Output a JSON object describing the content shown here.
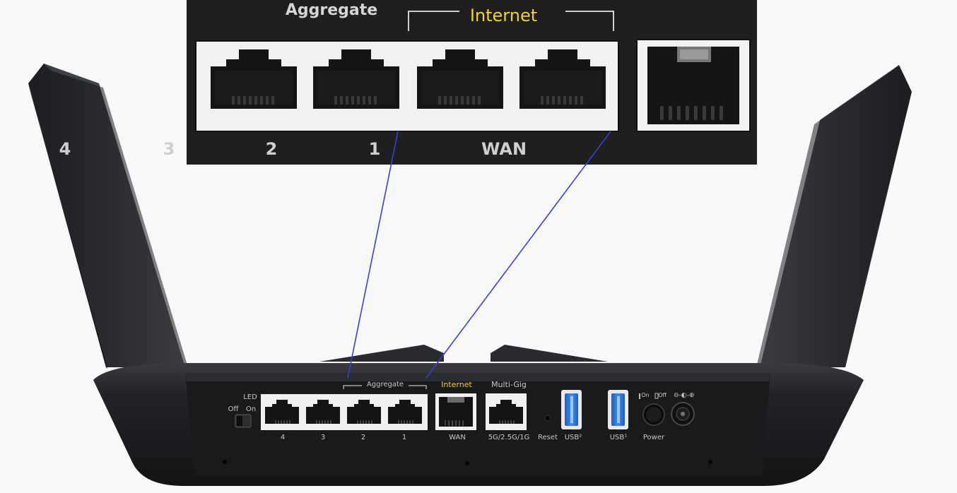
{
  "inset": {
    "aggregate_label": "Aggregate",
    "internet_label": "Internet",
    "port_numbers": [
      "4",
      "3",
      "2",
      "1"
    ],
    "wan_label": "WAN"
  },
  "panel": {
    "led_label": "LED",
    "led_off": "Off",
    "led_on": "On",
    "aggregate_label": "Aggregate",
    "internet_label": "Internet",
    "multigig_label": "Multi-Gig",
    "port_numbers": [
      "4",
      "3",
      "2",
      "1"
    ],
    "wan_label": "WAN",
    "multigig_speed": "5G/2.5G/1G",
    "reset_label": "Reset",
    "usb2_label": "USB²",
    "usb1_label": "USB¹",
    "power_label": "Power",
    "power_on": "On",
    "power_off": "Off",
    "dc_symbol": "⊖-◐-⊕"
  },
  "colors": {
    "internet_highlight": "#f2d320",
    "connector_lines": "#3d3dd8",
    "usb_blue": "#2f7ee0"
  },
  "icons": [
    "ethernet-port-icon",
    "usb-port-icon",
    "power-button-icon",
    "dc-jack-icon",
    "led-switch-icon"
  ]
}
